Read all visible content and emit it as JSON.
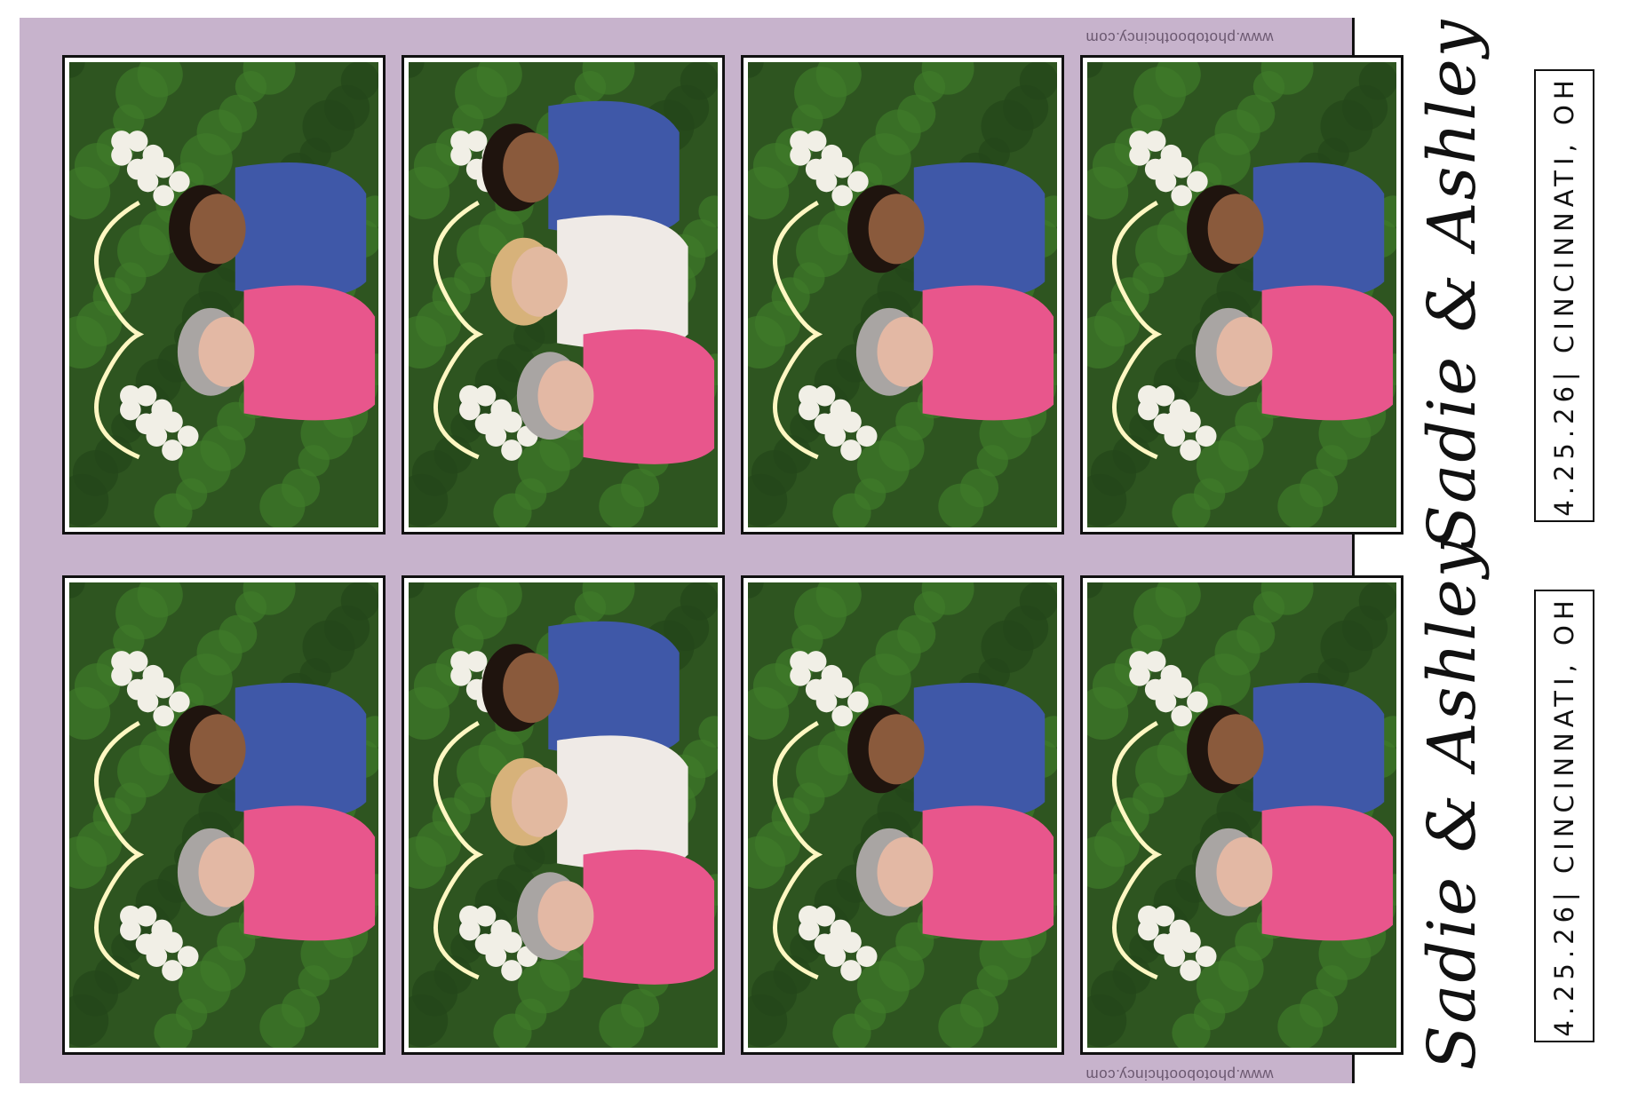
{
  "print": {
    "background_color": "#c7b3cc",
    "website": "www.photoboothcincy.com",
    "names": "Sadie & Ashley",
    "date_location": "4.25.26| CINCINNATI, OH"
  },
  "strips": [
    {
      "photos": [
        {
          "scene": "three-women-blue-dress-pink-top"
        },
        {
          "scene": "bride-with-two-guests"
        },
        {
          "scene": "two-women-laughing"
        },
        {
          "scene": "two-women-smiling"
        }
      ]
    },
    {
      "photos": [
        {
          "scene": "three-women-blue-dress-pink-top"
        },
        {
          "scene": "bride-with-two-guests"
        },
        {
          "scene": "two-women-laughing"
        },
        {
          "scene": "two-women-smiling"
        }
      ]
    }
  ]
}
